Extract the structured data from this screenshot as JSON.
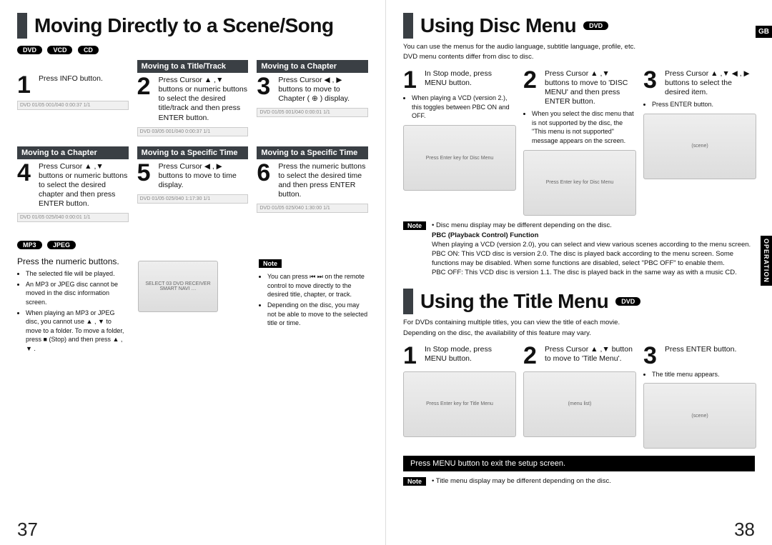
{
  "left": {
    "title": "Moving Directly to a Scene/Song",
    "pills_top": [
      "DVD",
      "VCD",
      "CD"
    ],
    "pills_bottom": [
      "MP3",
      "JPEG"
    ],
    "row1": {
      "c1": {
        "num": "1",
        "txt": "Press INFO button.",
        "status": "DVD  01/05  001/040  0:00:37  1/1"
      },
      "c2": {
        "h": "Moving to a Title/Track",
        "num": "2",
        "txt": "Press Cursor ▲ ,▼ buttons or numeric buttons to select the desired title/track and then press ENTER button.",
        "status": "DVD  03/05  001/040  0:00:37  1/1"
      },
      "c3": {
        "h": "Moving to a Chapter",
        "num": "3",
        "txt": "Press Cursor ◀ , ▶ buttons to move to Chapter ( ⊕ ) display.",
        "status": "DVD  01/05  001/040  0:00:01  1/1"
      }
    },
    "row2": {
      "c1": {
        "h": "Moving to a Chapter",
        "num": "4",
        "txt": "Press Cursor ▲ ,▼ buttons or numeric buttons to select the desired chapter and then press ENTER button.",
        "status": "DVD  01/05  025/040  0:00:01  1/1"
      },
      "c2": {
        "h": "Moving to a Specific Time",
        "num": "5",
        "txt": "Press Cursor ◀ , ▶ buttons to move to time display.",
        "status": "DVD  01/05  025/040  1:17:30  1/1"
      },
      "c3": {
        "h": "Moving to a Specific Time",
        "num": "6",
        "txt": "Press the numeric buttons to select the desired time and then press ENTER button.",
        "status": "DVD  01/05  025/040  1:30:00  1/1"
      }
    },
    "lower": {
      "instr": "Press the numeric buttons.",
      "bullets": [
        "The selected file will be played.",
        "An MP3 or JPEG disc cannot be moved in the disc information screen.",
        "When playing an MP3 or JPEG disc, you cannot use ▲ , ▼ to move to a folder. To move a folder, press ■ (Stop) and then press ▲ , ▼ ."
      ],
      "shotcap": "SELECT   03\nDVD RECEIVER   SMART NAVI\n…",
      "note_label": "Note",
      "note_bullets": [
        "You can press ⏮ ⏭ on the remote control to move directly to the desired title, chapter, or track.",
        "Depending on the disc, you may not be able to move to the selected title or time."
      ]
    },
    "pagenum": "37"
  },
  "right": {
    "lang": "GB",
    "vtab": "OPERATION",
    "disc": {
      "title": "Using Disc Menu",
      "pill": "DVD",
      "sub1": "You can use the menus for the audio language, subtitle language, profile, etc.",
      "sub2": "DVD menu contents differ from disc to disc.",
      "steps": {
        "s1": {
          "num": "1",
          "txt": "In Stop mode, press MENU button.",
          "bul": "When playing a VCD (version 2.), this toggles between PBC ON and OFF.",
          "shot": "Press Enter key\nfor Disc Menu"
        },
        "s2": {
          "num": "2",
          "txt": "Press Cursor ▲ ,▼ buttons to move to 'DISC MENU' and then press ENTER button.",
          "bul": "When you select the disc menu that is not supported by the disc, the \"This menu is not supported\" message appears on the screen.",
          "shot": "Press Enter key\nfor Disc Menu"
        },
        "s3": {
          "num": "3",
          "txt": "Press Cursor ▲ ,▼ ◀ , ▶ buttons to select the desired item.",
          "bul": "Press ENTER button.",
          "shot": "(scene)"
        }
      },
      "noteblock": {
        "label": "Note",
        "lines": [
          "Disc menu display may be different depending on the disc.",
          "PBC (Playback Control) Function",
          "When playing a VCD (version 2.0), you can select and view various scenes according to the menu screen.",
          "PBC ON: This VCD disc is version 2.0. The disc is played back according to the menu screen. Some functions may be disabled. When some functions are disabled, select \"PBC OFF\" to enable them.",
          "PBC OFF: This VCD disc is version 1.1. The disc is played back in the same way as with a music CD."
        ]
      }
    },
    "titlemenu": {
      "title": "Using the Title Menu",
      "pill": "DVD",
      "sub1": "For DVDs containing multiple titles, you can view the title of each movie.",
      "sub2": "Depending on the disc, the availability of this feature may vary.",
      "steps": {
        "s1": {
          "num": "1",
          "txt": "In Stop mode, press MENU button.",
          "shot": "Press Enter key\nfor Title Menu"
        },
        "s2": {
          "num": "2",
          "txt": "Press Cursor ▲ ,▼ button to move to 'Title Menu'.",
          "shot": "(menu list)"
        },
        "s3": {
          "num": "3",
          "txt": "Press ENTER button.",
          "bul": "The title menu appears.",
          "shot": "(scene)"
        }
      },
      "exit": "Press MENU button to exit the setup screen.",
      "footnote_label": "Note",
      "footnote": "Title menu display may be different depending on the disc."
    },
    "pagenum": "38"
  }
}
